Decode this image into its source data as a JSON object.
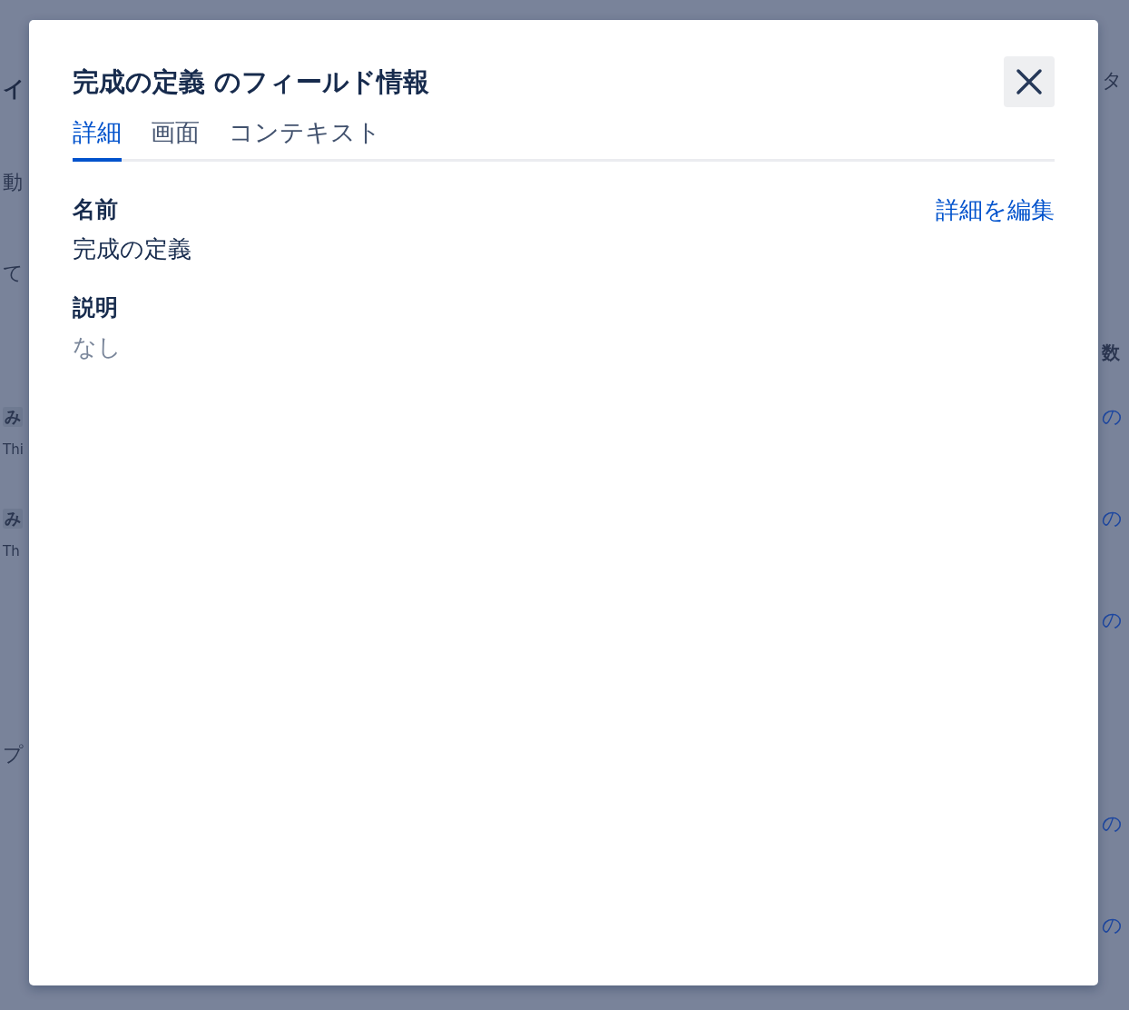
{
  "background": {
    "left_fragments": [
      {
        "text": "イ",
        "kind": "heading"
      },
      {
        "text": "動",
        "kind": "text"
      },
      {
        "text": "て",
        "kind": "text"
      },
      {
        "text": "み",
        "kind": "tag"
      },
      {
        "text": "Thi",
        "kind": "latin"
      },
      {
        "text": "み",
        "kind": "tag"
      },
      {
        "text": "Th",
        "kind": "latin"
      },
      {
        "text": "プ",
        "kind": "text"
      }
    ],
    "right_fragments": [
      {
        "text": "タ",
        "kind": "text"
      },
      {
        "text": "数",
        "kind": "header"
      },
      {
        "text": "の",
        "kind": "link"
      },
      {
        "text": "の",
        "kind": "link"
      },
      {
        "text": "の",
        "kind": "link"
      },
      {
        "text": "の",
        "kind": "link"
      },
      {
        "text": "の",
        "kind": "link"
      }
    ]
  },
  "dialog": {
    "title": "完成の定義 のフィールド情報",
    "tabs": [
      {
        "label": "詳細",
        "selected": true
      },
      {
        "label": "画面",
        "selected": false
      },
      {
        "label": "コンテキスト",
        "selected": false
      }
    ],
    "edit_link": "詳細を編集",
    "fields": [
      {
        "label": "名前",
        "value": "完成の定義",
        "empty": false
      },
      {
        "label": "説明",
        "value": "なし",
        "empty": true
      }
    ]
  }
}
